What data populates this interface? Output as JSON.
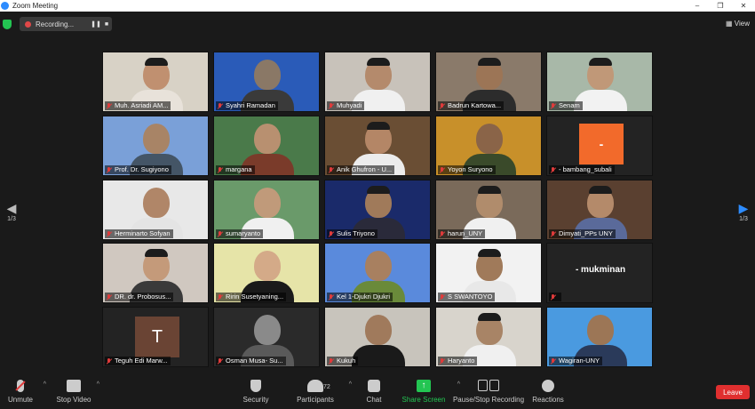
{
  "window": {
    "title": "Zoom Meeting",
    "minimize": "–",
    "restore": "❐",
    "close": "✕"
  },
  "recording": {
    "label": "Recording...",
    "pause": "❚❚",
    "stop": "■"
  },
  "view_label": "View",
  "paging": {
    "left_glyph": "◀",
    "right_glyph": "▶",
    "left_page": "1/3",
    "right_page": "1/3"
  },
  "tiles": [
    {
      "name": "Muh. Asriadi AM...",
      "bg": "#d8d2c6",
      "skin": "#c09070",
      "shirt": "#e8e2da",
      "cap": true
    },
    {
      "name": "Syahri Ramadan",
      "bg": "#2a5bb8",
      "skin": "#8a7866",
      "shirt": "#3a3a3a",
      "cap": false
    },
    {
      "name": "Muhyadi",
      "bg": "#c8c2ba",
      "skin": "#b48a6c",
      "shirt": "#f0f0f0",
      "cap": true
    },
    {
      "name": "Badrun Kartowa...",
      "bg": "#8a7a6a",
      "skin": "#9c7556",
      "shirt": "#2c2c2c",
      "cap": true
    },
    {
      "name": "Senam",
      "bg": "#a8b8a8",
      "skin": "#c09878",
      "shirt": "#f2f2f2",
      "cap": true
    },
    {
      "name": "Prof. Dr. Sugiyono",
      "bg": "#7aa0d8",
      "skin": "#a88466",
      "shirt": "#445566",
      "cap": false
    },
    {
      "name": "margana",
      "bg": "#4a7a4a",
      "skin": "#b89070",
      "shirt": "#7a3b2a",
      "cap": false
    },
    {
      "name": "Anik Ghufron - U...",
      "bg": "#6a4e34",
      "skin": "#b48666",
      "shirt": "#ececec",
      "cap": true
    },
    {
      "name": "Yoyon Suryono",
      "bg": "#c8902a",
      "skin": "#8a6448",
      "shirt": "#3a4a2a",
      "cap": false
    },
    {
      "name": "- bambang_subali",
      "type": "orange",
      "initial": "-"
    },
    {
      "name": "Herminarto Sofyan",
      "bg": "#e8e8e8",
      "skin": "#b08668",
      "shirt": "#e4e4e4",
      "cap": false
    },
    {
      "name": "sumaryanto",
      "bg": "#6a9a6a",
      "skin": "#c09a7a",
      "shirt": "#f0f0f0",
      "cap": false
    },
    {
      "name": "Sulis Triyono",
      "bg": "#1a2a6a",
      "skin": "#a07a5a",
      "shirt": "#2a2a3a",
      "cap": true
    },
    {
      "name": "harun_UNY",
      "bg": "#7a6a5a",
      "skin": "#b08c6c",
      "shirt": "#f0f0f0",
      "cap": true
    },
    {
      "name": "Dimyati_PPs UNY",
      "bg": "#5a4030",
      "skin": "#b48a6a",
      "shirt": "#5a6a9a",
      "cap": true
    },
    {
      "name": "DR. dr. Probosus...",
      "bg": "#d0c8c0",
      "skin": "#c49a7a",
      "shirt": "#3a3a3a",
      "cap": true
    },
    {
      "name": "Ririn Susetyaning...",
      "bg": "#e6e4a8",
      "skin": "#d4aa88",
      "shirt": "#1a1a1a",
      "cap": false
    },
    {
      "name": "Kel 1-Djukri Djukri",
      "bg": "#5a8adc",
      "skin": "#a88060",
      "shirt": "#6a8a3a",
      "cap": false
    },
    {
      "name": "S SWANTOYO",
      "bg": "#f2f2f2",
      "skin": "#a07a5a",
      "shirt": "#e8e8e8",
      "cap": true
    },
    {
      "name": "- mukminan",
      "type": "blank"
    },
    {
      "name": "Teguh Edi Marw...",
      "type": "brown",
      "initial": "T"
    },
    {
      "name": "Osman Musa- Su...",
      "bg": "#2a2a2a",
      "skin": "#8a8a8a",
      "shirt": "#5a5a5a",
      "cap": false
    },
    {
      "name": "Kukuh",
      "bg": "#c8c4bc",
      "skin": "#a07a5c",
      "shirt": "#1a1a1a",
      "cap": false
    },
    {
      "name": "Haryanto",
      "bg": "#d8d4cc",
      "skin": "#a88466",
      "shirt": "#f0f0f0",
      "cap": true
    },
    {
      "name": "Wagiran-UNY",
      "bg": "#4a9ae0",
      "skin": "#9c7656",
      "shirt": "#2a3a5a",
      "cap": false
    }
  ],
  "toolbar": {
    "unmute": "Unmute",
    "stop_video": "Stop Video",
    "security": "Security",
    "participants": "Participants",
    "participants_count": "72",
    "chat": "Chat",
    "share_screen": "Share Screen",
    "pause_stop_recording": "Pause/Stop Recording",
    "reactions": "Reactions",
    "leave": "Leave",
    "caret": "^"
  },
  "colors": {
    "accent_blue": "#2d8cff",
    "share_green": "#23c552",
    "leave_red": "#e02f2f"
  }
}
